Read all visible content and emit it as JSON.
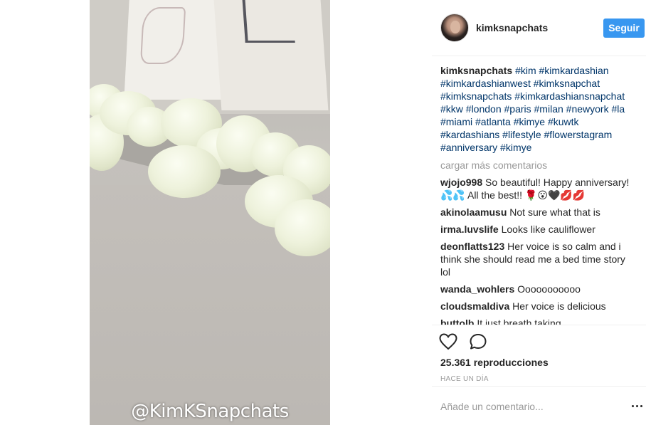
{
  "post": {
    "username": "kimksnapchats",
    "follow_label": "Seguir",
    "watermark": "@KimKSnapchats"
  },
  "caption": {
    "username": "kimksnapchats",
    "hashtags": "#kim #kimkardashian #kimkardashianwest #kimksnapchat #kimksnapchats #kimkardashiansnapchat #kkw #london #paris #milan #newyork #la #miami #atlanta #kimye #kuwtk #kardashians #lifestyle #flowerstagram #anniversary #kimye"
  },
  "load_more_label": "cargar más comentarios",
  "comments": [
    {
      "user": "wjojo998",
      "text": "So beautiful! Happy anniversary! 💦💦 All the best!! 🌹😮🖤💋💋"
    },
    {
      "user": "akinolaamusu",
      "text": "Not sure what that is"
    },
    {
      "user": "irma.luvslife",
      "text": "Looks like cauliflower"
    },
    {
      "user": "deonflatts123",
      "text": "Her voice is so calm and i think she should read me a bed time story lol"
    },
    {
      "user": "wanda_wohlers",
      "text": "Ooooooooooo"
    },
    {
      "user": "cloudsmaldiva",
      "text": "Her voice is delicious"
    },
    {
      "user": "buttolb",
      "text": "It just breath taking"
    }
  ],
  "actions": {
    "views": "25.361 reproducciones",
    "time": "HACE UN DÍA",
    "add_comment_placeholder": "Añade un comentario..."
  },
  "colors": {
    "accent": "#3897f0",
    "hashtag": "#003569",
    "muted": "#999999"
  },
  "icons": [
    "heart-icon",
    "comment-icon",
    "more-options-icon"
  ]
}
